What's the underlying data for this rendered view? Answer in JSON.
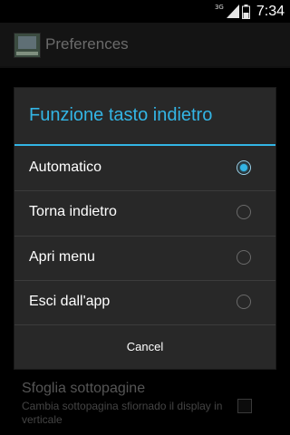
{
  "status_bar": {
    "network": "3G",
    "time": "7:34"
  },
  "action_bar": {
    "title": "Preferences"
  },
  "background_pref": {
    "title": "Sfoglia sottopagine",
    "summary": "Cambia sottopagina sfiornado il display in verticale",
    "checked": false
  },
  "dialog": {
    "title": "Funzione tasto indietro",
    "options": [
      {
        "label": "Automatico",
        "selected": true
      },
      {
        "label": "Torna indietro",
        "selected": false
      },
      {
        "label": "Apri menu",
        "selected": false
      },
      {
        "label": "Esci dall'app",
        "selected": false
      }
    ],
    "cancel_label": "Cancel"
  },
  "colors": {
    "accent": "#33b5e5",
    "dialog_bg": "#282828",
    "screen_bg": "#000000"
  }
}
